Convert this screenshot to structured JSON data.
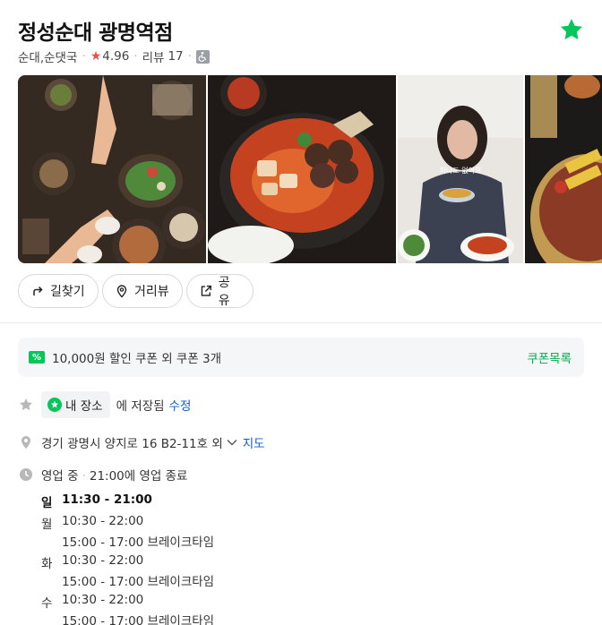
{
  "place": {
    "name": "정성순대 광명역점",
    "category": "순대,순댓국",
    "rating": "4.96",
    "review_label": "리뷰",
    "review_count": "17"
  },
  "actions": {
    "directions": "길찾기",
    "street_view": "거리뷰",
    "share": "공유"
  },
  "coupon": {
    "text": "10,000원 할인 쿠폰 외 쿠폰 3개",
    "link": "쿠폰목록"
  },
  "saved": {
    "my_place": "내 장소",
    "saved_text": "에 저장됨",
    "edit": "수정"
  },
  "address": {
    "text": "경기 광명시 양지로 16 B2-11호 외",
    "map_link": "지도"
  },
  "hours": {
    "status": "영업 중",
    "closing": "21:00에 영업 종료",
    "days": [
      {
        "day": "일",
        "time": "11:30 - 21:00",
        "break": "",
        "today": true
      },
      {
        "day": "월",
        "time": "10:30 - 22:00",
        "break": "15:00 - 17:00 브레이크타임",
        "today": false
      },
      {
        "day": "화",
        "time": "10:30 - 22:00",
        "break": "15:00 - 17:00 브레이크타임",
        "today": false
      },
      {
        "day": "수",
        "time": "10:30 - 22:00",
        "break": "15:00 - 17:00 브레이크타임",
        "today": false
      }
    ]
  },
  "photo_overlay_text": "하나도 없어요",
  "colors": {
    "green": "#03c75a",
    "link_blue": "#0b5fcb",
    "rating_red": "#f04b4b"
  }
}
